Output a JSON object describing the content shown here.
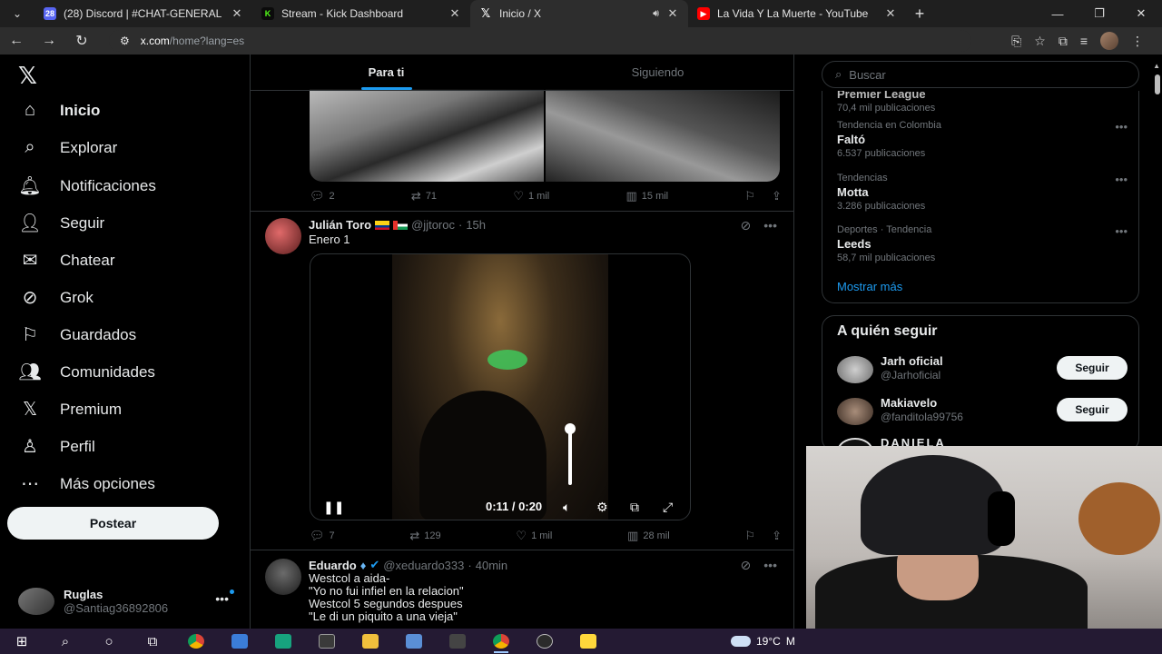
{
  "browser": {
    "tabs": [
      {
        "title": "(28) Discord | #CHAT-GENERAL",
        "badge": "28",
        "favicon_color": "#5865f2"
      },
      {
        "title": "Stream - Kick Dashboard",
        "favicon_color": "#53fc18"
      },
      {
        "title": "Inicio / X",
        "active": true
      },
      {
        "title": "La Vida Y La Muerte - YouTube",
        "favicon_color": "#ff0000"
      }
    ],
    "url_host": "x.com",
    "url_rest": "/home?lang=es"
  },
  "nav": {
    "items": [
      {
        "label": "Inicio",
        "icon": "home-icon"
      },
      {
        "label": "Explorar",
        "icon": "search-icon"
      },
      {
        "label": "Notificaciones",
        "icon": "bell-icon"
      },
      {
        "label": "Seguir",
        "icon": "add-person-icon"
      },
      {
        "label": "Chatear",
        "icon": "mail-icon"
      },
      {
        "label": "Grok",
        "icon": "grok-icon"
      },
      {
        "label": "Guardados",
        "icon": "bookmark-icon"
      },
      {
        "label": "Comunidades",
        "icon": "people-icon"
      },
      {
        "label": "Premium",
        "icon": "x-icon"
      },
      {
        "label": "Perfil",
        "icon": "person-icon"
      },
      {
        "label": "Más opciones",
        "icon": "more-circle-icon"
      }
    ],
    "post_button": "Postear",
    "account": {
      "name": "Ruglas",
      "handle": "@Santiag36892806"
    }
  },
  "feed": {
    "tabs": [
      "Para ti",
      "Siguiendo"
    ],
    "top_post_stats": {
      "replies": "2",
      "reposts": "71",
      "likes": "1 mil",
      "views": "15 mil"
    },
    "posts": [
      {
        "name": "Julián Toro",
        "handle": "@jjtoroc",
        "time": "15h",
        "text": "Enero 1",
        "video_time": "0:11 / 0:20",
        "stats": {
          "replies": "7",
          "reposts": "129",
          "likes": "1 mil",
          "views": "28 mil"
        }
      },
      {
        "name": "Eduardo",
        "handle": "@xeduardo333",
        "time": "40min",
        "text": "Westcol a aida-\n\"Yo no fui infiel en la relacion\"\nWestcol 5 segundos despues\n\"Le di un piquito a una vieja\""
      }
    ]
  },
  "sidebar": {
    "search_placeholder": "Buscar",
    "trends": [
      {
        "category": "",
        "title": "Premier League",
        "count": "70,4 mil publicaciones"
      },
      {
        "category": "Tendencia en Colombia",
        "title": "Faltó",
        "count": "6.537 publicaciones"
      },
      {
        "category": "Tendencias",
        "title": "Motta",
        "count": "3.286 publicaciones"
      },
      {
        "category": "Deportes · Tendencia",
        "title": "Leeds",
        "count": "58,7 mil publicaciones"
      }
    ],
    "show_more": "Mostrar más",
    "who_to_follow_title": "A quién seguir",
    "suggestions": [
      {
        "name": "Jarh oficial",
        "handle": "@Jarhoficial",
        "button": "Seguir"
      },
      {
        "name": "Makiavelo",
        "handle": "@fanditola99756",
        "button": "Seguir"
      },
      {
        "name": "DANIELA",
        "handle": "",
        "button": ""
      }
    ]
  },
  "taskbar": {
    "weather": "19°C",
    "weather_suffix": "M"
  },
  "colors": {
    "accent": "#1d9bf0",
    "background": "#000000",
    "text": "#e7e9ea",
    "muted": "#71767b"
  }
}
